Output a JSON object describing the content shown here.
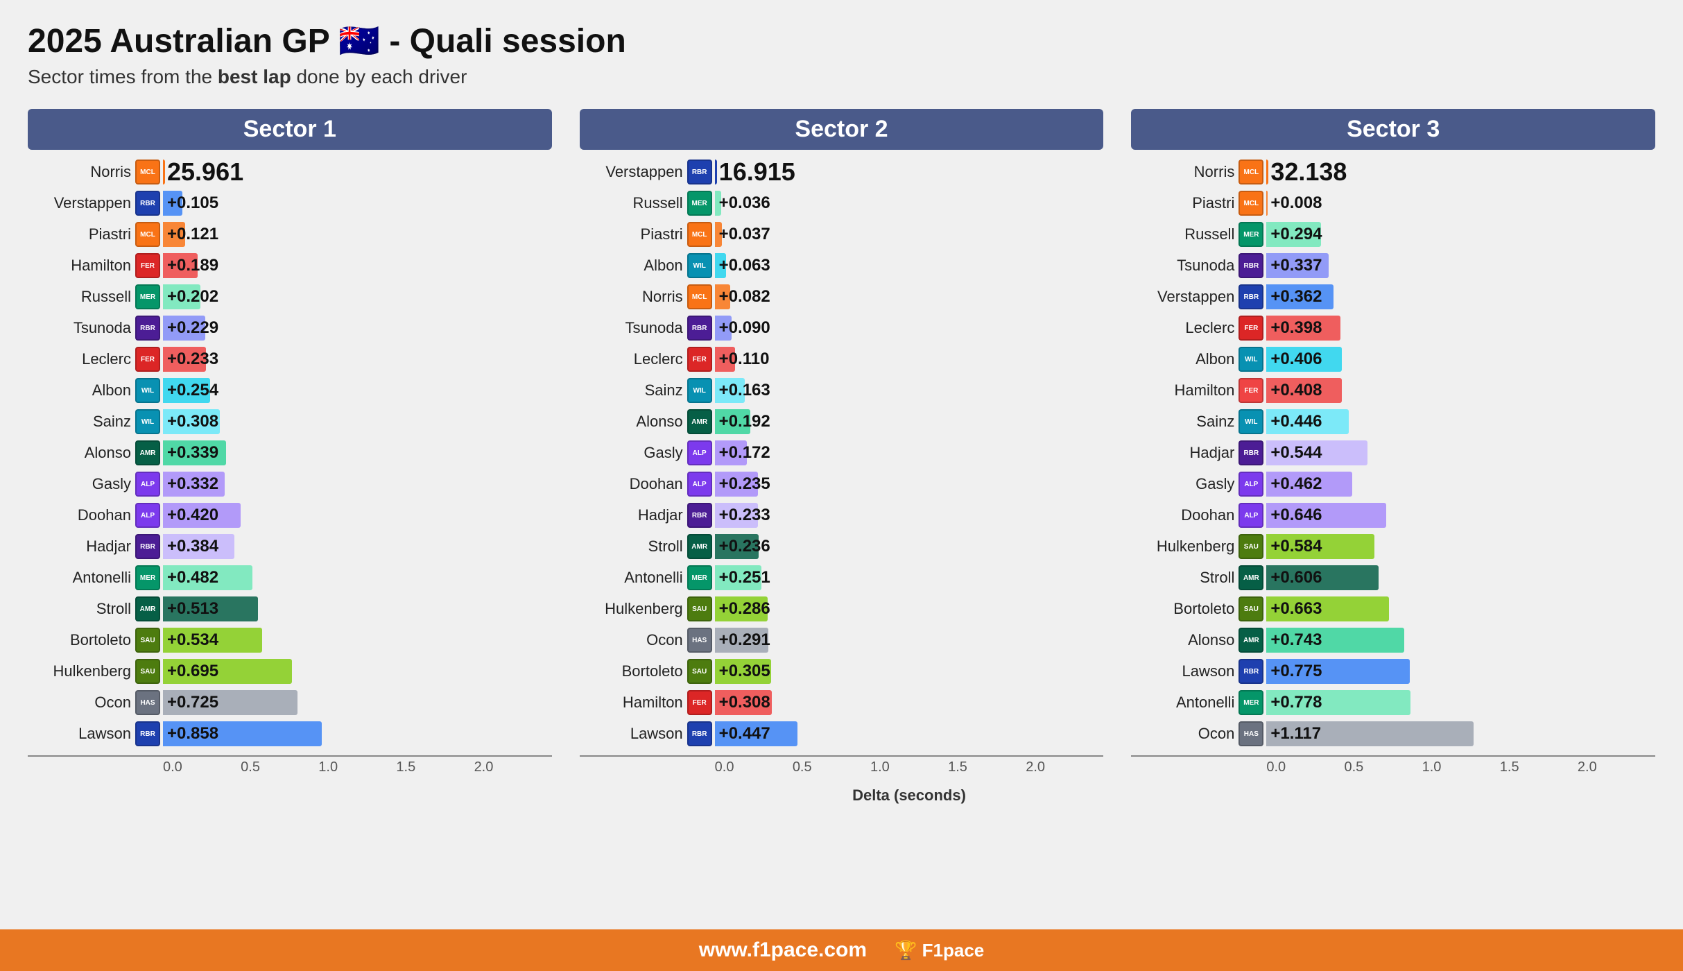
{
  "title": "2025 Australian GP",
  "flag": "🇦🇺",
  "title_suffix": "- Quali session",
  "subtitle_pre": "Sector times from the ",
  "subtitle_bold": "best lap",
  "subtitle_post": " done by each driver",
  "footer": {
    "url": "www.f1pace.com",
    "logo": "🏆 F1pace"
  },
  "axis": {
    "ticks": [
      "0.0",
      "0.5",
      "1.0",
      "1.5",
      "2.0"
    ],
    "label": "Delta (seconds)"
  },
  "sectors": [
    {
      "label": "Sector 1",
      "best_driver": "Norris",
      "best_time": "25.961",
      "max_delta": 2.1,
      "drivers": [
        {
          "name": "Norris",
          "delta": 0,
          "value": "25.961",
          "color": "#F97316",
          "team": "MCL",
          "team_color": "#F97316"
        },
        {
          "name": "Verstappen",
          "delta": 0.105,
          "value": "+0.105",
          "color": "#3B82F6",
          "team": "RBR",
          "team_color": "#1E40AF"
        },
        {
          "name": "Piastri",
          "delta": 0.121,
          "value": "+0.121",
          "color": "#F97316",
          "team": "MCL",
          "team_color": "#F97316"
        },
        {
          "name": "Hamilton",
          "delta": 0.189,
          "value": "+0.189",
          "color": "#EF4444",
          "team": "FER",
          "team_color": "#DC2626"
        },
        {
          "name": "Russell",
          "delta": 0.202,
          "value": "+0.202",
          "color": "#6EE7B7",
          "team": "MER",
          "team_color": "#059669"
        },
        {
          "name": "Tsunoda",
          "delta": 0.229,
          "value": "+0.229",
          "color": "#818CF8",
          "team": "RBR",
          "team_color": "#4C1D95"
        },
        {
          "name": "Leclerc",
          "delta": 0.233,
          "value": "+0.233",
          "color": "#EF4444",
          "team": "FER",
          "team_color": "#DC2626"
        },
        {
          "name": "Albon",
          "delta": 0.254,
          "value": "+0.254",
          "color": "#22D3EE",
          "team": "WIL",
          "team_color": "#0891B2"
        },
        {
          "name": "Sainz",
          "delta": 0.308,
          "value": "+0.308",
          "color": "#67E8F9",
          "team": "WIL",
          "team_color": "#0891B2"
        },
        {
          "name": "Alonso",
          "delta": 0.339,
          "value": "+0.339",
          "color": "#34D399",
          "team": "AMR",
          "team_color": "#065F46"
        },
        {
          "name": "Gasly",
          "delta": 0.332,
          "value": "+0.332",
          "color": "#A78BFA",
          "team": "ALP",
          "team_color": "#7C3AED"
        },
        {
          "name": "Doohan",
          "delta": 0.42,
          "value": "+0.420",
          "color": "#A78BFA",
          "team": "ALP",
          "team_color": "#7C3AED"
        },
        {
          "name": "Hadjar",
          "delta": 0.384,
          "value": "+0.384",
          "color": "#C4B5FD",
          "team": "RBR",
          "team_color": "#4C1D95"
        },
        {
          "name": "Antonelli",
          "delta": 0.482,
          "value": "+0.482",
          "color": "#6EE7B7",
          "team": "MER",
          "team_color": "#059669"
        },
        {
          "name": "Stroll",
          "delta": 0.513,
          "value": "+0.513",
          "color": "#065F46",
          "team": "AMR",
          "team_color": "#065F46"
        },
        {
          "name": "Bortoleto",
          "delta": 0.534,
          "value": "+0.534",
          "color": "#84CC16",
          "team": "SAU",
          "team_color": "#4D7C0F"
        },
        {
          "name": "Hulkenberg",
          "delta": 0.695,
          "value": "+0.695",
          "color": "#84CC16",
          "team": "SAU",
          "team_color": "#4D7C0F"
        },
        {
          "name": "Ocon",
          "delta": 0.725,
          "value": "+0.725",
          "color": "#9CA3AF",
          "team": "HAS",
          "team_color": "#6B7280"
        },
        {
          "name": "Lawson",
          "delta": 0.858,
          "value": "+0.858",
          "color": "#3B82F6",
          "team": "RBR",
          "team_color": "#1E40AF"
        }
      ]
    },
    {
      "label": "Sector 2",
      "best_driver": "Verstappen",
      "best_time": "16.915",
      "max_delta": 2.1,
      "drivers": [
        {
          "name": "Verstappen",
          "delta": 0,
          "value": "16.915",
          "color": "#1E40AF",
          "team": "RBR",
          "team_color": "#1E40AF"
        },
        {
          "name": "Russell",
          "delta": 0.036,
          "value": "+0.036",
          "color": "#6EE7B7",
          "team": "MER",
          "team_color": "#059669"
        },
        {
          "name": "Piastri",
          "delta": 0.037,
          "value": "+0.037",
          "color": "#F97316",
          "team": "MCL",
          "team_color": "#F97316"
        },
        {
          "name": "Albon",
          "delta": 0.063,
          "value": "+0.063",
          "color": "#22D3EE",
          "team": "WIL",
          "team_color": "#0891B2"
        },
        {
          "name": "Norris",
          "delta": 0.082,
          "value": "+0.082",
          "color": "#F97316",
          "team": "MCL",
          "team_color": "#F97316"
        },
        {
          "name": "Tsunoda",
          "delta": 0.09,
          "value": "+0.090",
          "color": "#818CF8",
          "team": "RBR",
          "team_color": "#4C1D95"
        },
        {
          "name": "Leclerc",
          "delta": 0.11,
          "value": "+0.110",
          "color": "#EF4444",
          "team": "FER",
          "team_color": "#DC2626"
        },
        {
          "name": "Sainz",
          "delta": 0.163,
          "value": "+0.163",
          "color": "#67E8F9",
          "team": "WIL",
          "team_color": "#0891B2"
        },
        {
          "name": "Alonso",
          "delta": 0.192,
          "value": "+0.192",
          "color": "#34D399",
          "team": "AMR",
          "team_color": "#065F46"
        },
        {
          "name": "Gasly",
          "delta": 0.172,
          "value": "+0.172",
          "color": "#A78BFA",
          "team": "ALP",
          "team_color": "#7C3AED"
        },
        {
          "name": "Doohan",
          "delta": 0.235,
          "value": "+0.235",
          "color": "#A78BFA",
          "team": "ALP",
          "team_color": "#7C3AED"
        },
        {
          "name": "Hadjar",
          "delta": 0.233,
          "value": "+0.233",
          "color": "#C4B5FD",
          "team": "RBR",
          "team_color": "#4C1D95"
        },
        {
          "name": "Stroll",
          "delta": 0.236,
          "value": "+0.236",
          "color": "#065F46",
          "team": "AMR",
          "team_color": "#065F46"
        },
        {
          "name": "Antonelli",
          "delta": 0.251,
          "value": "+0.251",
          "color": "#6EE7B7",
          "team": "MER",
          "team_color": "#059669"
        },
        {
          "name": "Hulkenberg",
          "delta": 0.286,
          "value": "+0.286",
          "color": "#84CC16",
          "team": "SAU",
          "team_color": "#4D7C0F"
        },
        {
          "name": "Ocon",
          "delta": 0.291,
          "value": "+0.291",
          "color": "#9CA3AF",
          "team": "HAS",
          "team_color": "#6B7280"
        },
        {
          "name": "Bortoleto",
          "delta": 0.305,
          "value": "+0.305",
          "color": "#84CC16",
          "team": "SAU",
          "team_color": "#4D7C0F"
        },
        {
          "name": "Hamilton",
          "delta": 0.308,
          "value": "+0.308",
          "color": "#EF4444",
          "team": "FER",
          "team_color": "#DC2626"
        },
        {
          "name": "Lawson",
          "delta": 0.447,
          "value": "+0.447",
          "color": "#3B82F6",
          "team": "RBR",
          "team_color": "#1E40AF"
        }
      ]
    },
    {
      "label": "Sector 3",
      "best_driver": "Norris",
      "best_time": "32.138",
      "max_delta": 2.1,
      "drivers": [
        {
          "name": "Norris",
          "delta": 0,
          "value": "32.138",
          "color": "#F97316",
          "team": "MCL",
          "team_color": "#F97316"
        },
        {
          "name": "Piastri",
          "delta": 0.008,
          "value": "+0.008",
          "color": "#F97316",
          "team": "MCL",
          "team_color": "#F97316"
        },
        {
          "name": "Russell",
          "delta": 0.294,
          "value": "+0.294",
          "color": "#6EE7B7",
          "team": "MER",
          "team_color": "#059669"
        },
        {
          "name": "Tsunoda",
          "delta": 0.337,
          "value": "+0.337",
          "color": "#818CF8",
          "team": "RBR",
          "team_color": "#4C1D95"
        },
        {
          "name": "Verstappen",
          "delta": 0.362,
          "value": "+0.362",
          "color": "#3B82F6",
          "team": "RBR",
          "team_color": "#1E40AF"
        },
        {
          "name": "Leclerc",
          "delta": 0.398,
          "value": "+0.398",
          "color": "#EF4444",
          "team": "FER",
          "team_color": "#DC2626"
        },
        {
          "name": "Albon",
          "delta": 0.406,
          "value": "+0.406",
          "color": "#22D3EE",
          "team": "WIL",
          "team_color": "#0891B2"
        },
        {
          "name": "Hamilton",
          "delta": 0.408,
          "value": "+0.408",
          "color": "#EF4444",
          "team": "FER",
          "team_color": "#EF4444"
        },
        {
          "name": "Sainz",
          "delta": 0.446,
          "value": "+0.446",
          "color": "#67E8F9",
          "team": "WIL",
          "team_color": "#0891B2"
        },
        {
          "name": "Hadjar",
          "delta": 0.544,
          "value": "+0.544",
          "color": "#C4B5FD",
          "team": "RBR",
          "team_color": "#4C1D95"
        },
        {
          "name": "Gasly",
          "delta": 0.462,
          "value": "+0.462",
          "color": "#A78BFA",
          "team": "ALP",
          "team_color": "#7C3AED"
        },
        {
          "name": "Doohan",
          "delta": 0.646,
          "value": "+0.646",
          "color": "#A78BFA",
          "team": "ALP",
          "team_color": "#7C3AED"
        },
        {
          "name": "Hulkenberg",
          "delta": 0.584,
          "value": "+0.584",
          "color": "#84CC16",
          "team": "SAU",
          "team_color": "#4D7C0F"
        },
        {
          "name": "Stroll",
          "delta": 0.606,
          "value": "+0.606",
          "color": "#065F46",
          "team": "AMR",
          "team_color": "#065F46"
        },
        {
          "name": "Bortoleto",
          "delta": 0.663,
          "value": "+0.663",
          "color": "#84CC16",
          "team": "SAU",
          "team_color": "#4D7C0F"
        },
        {
          "name": "Alonso",
          "delta": 0.743,
          "value": "+0.743",
          "color": "#34D399",
          "team": "AMR",
          "team_color": "#065F46"
        },
        {
          "name": "Lawson",
          "delta": 0.775,
          "value": "+0.775",
          "color": "#3B82F6",
          "team": "RBR",
          "team_color": "#1E40AF"
        },
        {
          "name": "Antonelli",
          "delta": 0.778,
          "value": "+0.778",
          "color": "#6EE7B7",
          "team": "MER",
          "team_color": "#059669"
        },
        {
          "name": "Ocon",
          "delta": 1.117,
          "value": "+1.117",
          "color": "#9CA3AF",
          "team": "HAS",
          "team_color": "#6B7280"
        }
      ]
    }
  ]
}
